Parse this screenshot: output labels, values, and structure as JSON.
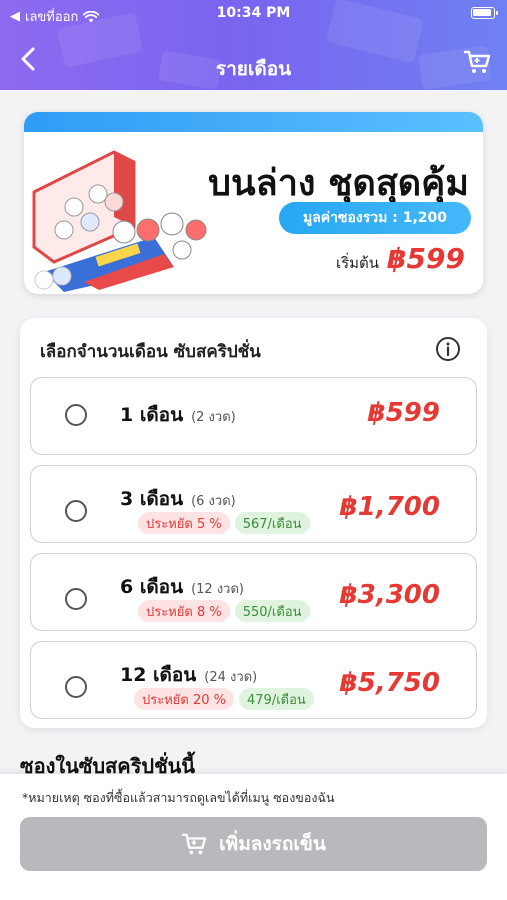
{
  "status_bar": {
    "carrier": "เลขที่ออก",
    "time": "10:34 PM"
  },
  "header": {
    "title": "รายเดือน",
    "icons": {
      "back": "chevron-left-icon",
      "cart": "cart-icon"
    }
  },
  "hero": {
    "title": "บนล่าง ชุดสุดคุ้ม",
    "value_pill": "มูลค่าซองรวม : 1,200",
    "start_label": "เริ่มต้น",
    "start_price": "฿599"
  },
  "plans": {
    "heading": "เลือกจำนวนเดือน ซับสคริปชั่น",
    "options": [
      {
        "months": "1 เดือน",
        "draws": "(2 งวด)",
        "price": "฿599",
        "saving": "",
        "per_month": "",
        "selected": false
      },
      {
        "months": "3 เดือน",
        "draws": "(6 งวด)",
        "price": "฿1,700",
        "saving": "ประหยัด 5 %",
        "per_month": "567/เดือน",
        "selected": false
      },
      {
        "months": "6 เดือน",
        "draws": "(12 งวด)",
        "price": "฿3,300",
        "saving": "ประหยัด 8 %",
        "per_month": "550/เดือน",
        "selected": false
      },
      {
        "months": "12 เดือน",
        "draws": "(24 งวด)",
        "price": "฿5,750",
        "saving": "ประหยัด 20 %",
        "per_month": "479/เดือน",
        "selected": false
      }
    ]
  },
  "section": {
    "title": "ซองในซับสคริปชั่นนี้"
  },
  "footer": {
    "note": "*หมายเหตุ ซองที่ซื้อแล้วสามารถดูเลขได้ที่เมนู ซองของฉัน",
    "add_to_cart_label": "เพิ่มลงรถเข็น"
  },
  "colors": {
    "header_start": "#8e6bf0",
    "header_end": "#6f80f2",
    "price_red": "#e53935",
    "pill_blue": "#27a8f2",
    "button_disabled": "#b9b9bd"
  }
}
